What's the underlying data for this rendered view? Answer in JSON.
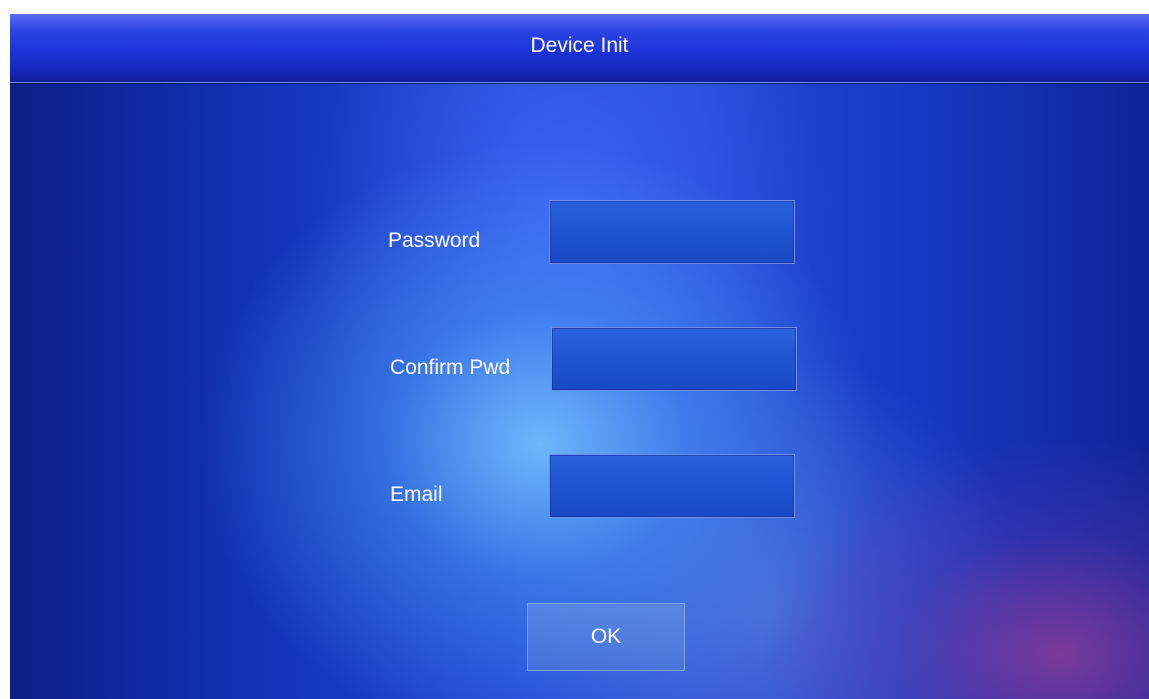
{
  "header": {
    "title": "Device Init"
  },
  "form": {
    "password": {
      "label": "Password",
      "value": "",
      "placeholder": ""
    },
    "confirm_password": {
      "label": "Confirm Pwd",
      "value": "",
      "placeholder": ""
    },
    "email": {
      "label": "Email",
      "value": "",
      "placeholder": ""
    }
  },
  "actions": {
    "ok_label": "OK"
  },
  "colors": {
    "title_bar": "#1c33d6",
    "background": "#2447d6",
    "field_fill": "#1f55d2",
    "field_border": "#6f8ee8",
    "text": "#ffffff"
  }
}
